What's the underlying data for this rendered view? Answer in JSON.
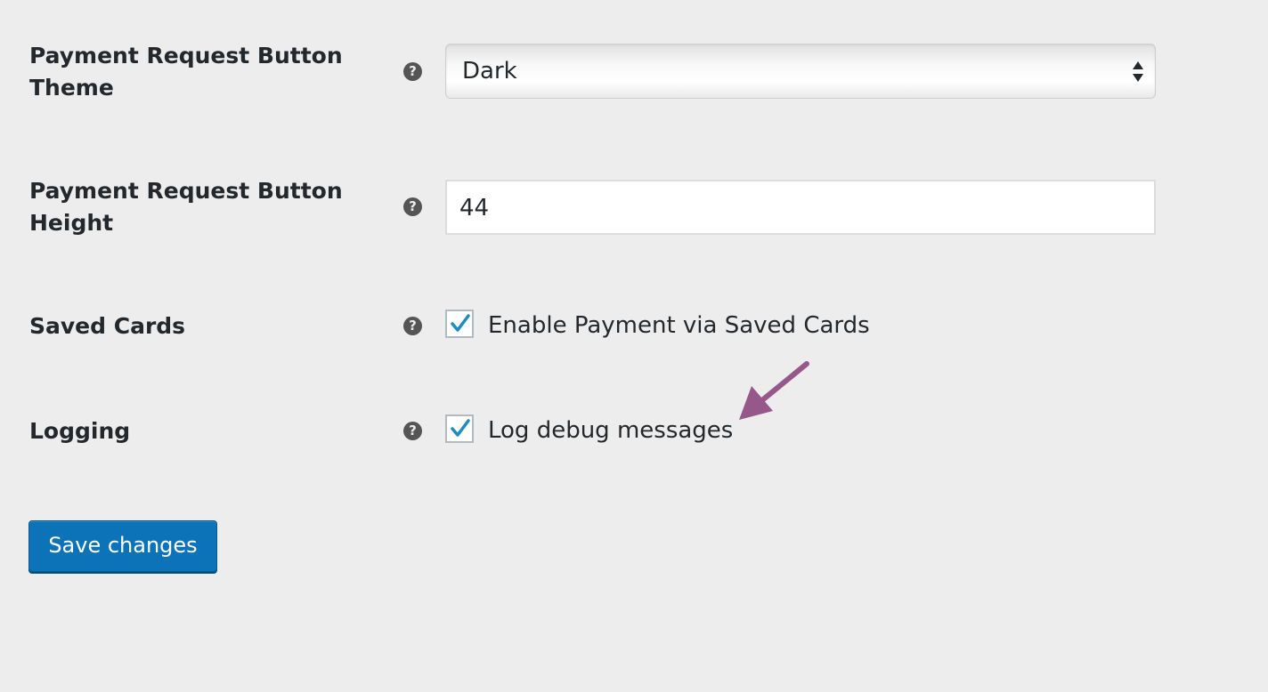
{
  "settings": {
    "theme": {
      "label": "Payment Request Button Theme",
      "help_icon": "question-circle-icon",
      "value": "Dark"
    },
    "height": {
      "label": "Payment Request Button Height",
      "help_icon": "question-circle-icon",
      "value": "44"
    },
    "saved_cards": {
      "label": "Saved Cards",
      "help_icon": "question-circle-icon",
      "checkbox_label": "Enable Payment via Saved Cards",
      "checked": true
    },
    "logging": {
      "label": "Logging",
      "help_icon": "question-circle-icon",
      "checkbox_label": "Log debug messages",
      "checked": true
    }
  },
  "help_glyph": "?",
  "save_button": {
    "label": "Save changes"
  },
  "colors": {
    "background": "#ededed",
    "primary_button": "#0c73b8",
    "checkmark": "#1e8cbe",
    "annotation_arrow": "#96588a"
  },
  "annotation": {
    "icon": "arrow-pointer-icon"
  }
}
